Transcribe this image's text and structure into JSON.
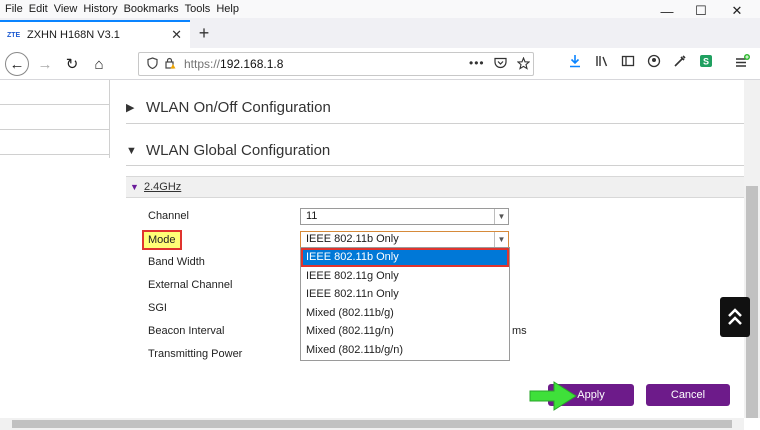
{
  "menu": {
    "file": "File",
    "edit": "Edit",
    "view": "View",
    "history": "History",
    "bookmarks": "Bookmarks",
    "tools": "Tools",
    "help": "Help"
  },
  "window": {
    "minimize": "—",
    "maximize": "☐",
    "close": "✕"
  },
  "tab": {
    "favicon_text": "ZTE",
    "title": "ZXHN H168N V3.1",
    "close": "✕",
    "new": "+"
  },
  "nav": {
    "back": "←",
    "forward": "→",
    "reload": "↻",
    "home": "⌂",
    "url_protocol": "https://",
    "url_host": "192.168.1.8",
    "page_actions": "•••"
  },
  "sections": {
    "wlan_onoff": "WLAN On/Off Configuration",
    "wlan_global": "WLAN Global Configuration",
    "band": "2.4GHz"
  },
  "form": {
    "channel_label": "Channel",
    "channel_value": "11",
    "mode_label": "Mode",
    "mode_value": "IEEE 802.11b Only",
    "bandwidth_label": "Band Width",
    "external_channel_label": "External Channel",
    "sgi_label": "SGI",
    "beacon_interval_label": "Beacon Interval",
    "beacon_unit": "ms",
    "tx_power_label": "Transmitting Power"
  },
  "mode_options": [
    "IEEE 802.11b Only",
    "IEEE 802.11g Only",
    "IEEE 802.11n Only",
    "Mixed (802.11b/g)",
    "Mixed (802.11g/n)",
    "Mixed (802.11b/g/n)"
  ],
  "buttons": {
    "apply": "Apply",
    "cancel": "Cancel"
  },
  "colors": {
    "accent_purple": "#6d1b8a",
    "highlight_red": "#e0342e",
    "selection_blue": "#0078d7",
    "arrow_green": "#3fe03a"
  },
  "icons": {
    "download": "download-icon",
    "library": "library-icon",
    "sidebar": "sidebar-icon",
    "account": "account-icon",
    "eyedropper": "eyedropper-icon",
    "extension": "extension-icon",
    "menu": "hamburger-menu-icon",
    "scroll_top": "double-chevron-up-icon"
  }
}
